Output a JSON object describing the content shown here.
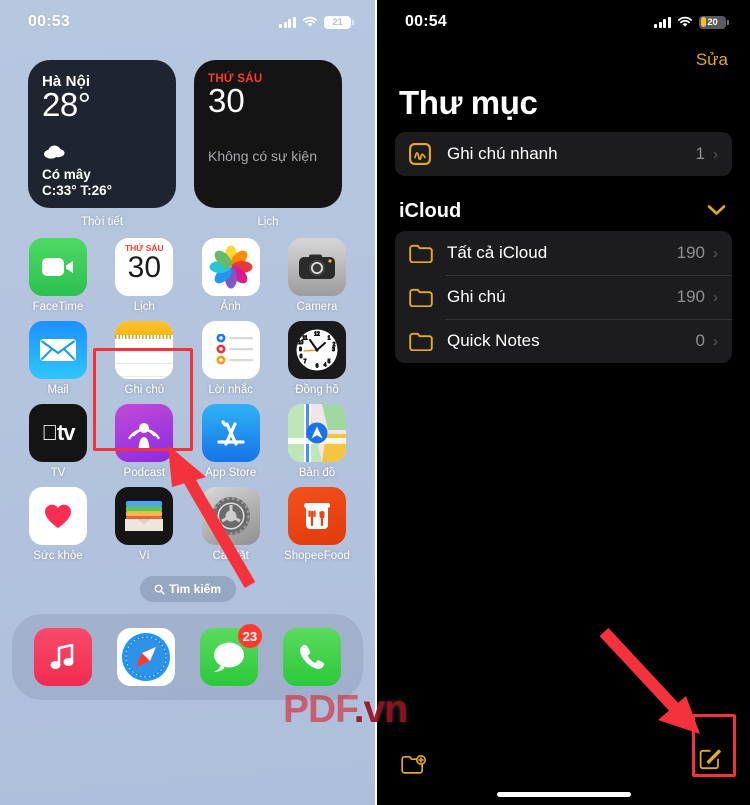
{
  "left_phone": {
    "status_bar": {
      "time": "00:53",
      "battery_level": "21",
      "wifi_icon": "wifi-icon",
      "signal_icon": "cellular-bars-icon"
    },
    "widgets": [
      {
        "name": "weather",
        "label": "Thời tiết",
        "city": "Hà Nội",
        "temperature": "28°",
        "condition": "Có mây",
        "high_low": "C:33° T:26°",
        "condition_icon": "cloud-icon"
      },
      {
        "name": "calendar",
        "label": "Lịch",
        "day_of_week": "THỨ SÁU",
        "day_number": "30",
        "empty_text": "Không có sự kiện"
      }
    ],
    "apps": [
      [
        {
          "label": "FaceTime",
          "icon": "facetime-icon"
        },
        {
          "label": "Lịch",
          "icon": "calendar-icon",
          "badge_dow": "THỨ SÁU",
          "badge_day": "30"
        },
        {
          "label": "Ảnh",
          "icon": "photos-icon"
        },
        {
          "label": "Camera",
          "icon": "camera-icon"
        }
      ],
      [
        {
          "label": "Mail",
          "icon": "mail-icon"
        },
        {
          "label": "Ghi chú",
          "icon": "notes-icon",
          "highlighted": true
        },
        {
          "label": "Lời nhắc",
          "icon": "reminders-icon"
        },
        {
          "label": "Đồng hồ",
          "icon": "clock-icon"
        }
      ],
      [
        {
          "label": "TV",
          "icon": "apple-tv-icon"
        },
        {
          "label": "Podcast",
          "icon": "podcasts-icon"
        },
        {
          "label": "App Store",
          "icon": "app-store-icon"
        },
        {
          "label": "Bản đồ",
          "icon": "maps-icon"
        }
      ],
      [
        {
          "label": "Sức khỏe",
          "icon": "health-icon"
        },
        {
          "label": "Ví",
          "icon": "wallet-icon"
        },
        {
          "label": "Cài đặt",
          "icon": "settings-gear-icon"
        },
        {
          "label": "ShopeeFood",
          "icon": "shopeefood-icon"
        }
      ]
    ],
    "search": {
      "label": "Tìm kiếm",
      "icon": "search-icon"
    },
    "dock": [
      {
        "label": "Music",
        "icon": "music-icon"
      },
      {
        "label": "Safari",
        "icon": "safari-compass-icon"
      },
      {
        "label": "Messages",
        "icon": "messages-icon",
        "badge": "23"
      },
      {
        "label": "Phone",
        "icon": "phone-icon"
      }
    ]
  },
  "right_phone": {
    "status_bar": {
      "time": "00:54",
      "battery_level": "20",
      "wifi_icon": "wifi-icon",
      "signal_icon": "cellular-bars-icon"
    },
    "nav": {
      "edit_label": "Sửa"
    },
    "title": "Thư mục",
    "quick_group": [
      {
        "title": "Ghi chú nhanh",
        "count": "1",
        "icon": "quick-note-icon",
        "chevron": "›"
      }
    ],
    "section": {
      "title": "iCloud",
      "collapse_icon": "chevron-down-icon"
    },
    "folders": [
      {
        "title": "Tất cả iCloud",
        "count": "190",
        "icon": "folder-icon",
        "chevron": "›"
      },
      {
        "title": "Ghi chú",
        "count": "190",
        "icon": "folder-icon",
        "chevron": "›"
      },
      {
        "title": "Quick Notes",
        "count": "0",
        "icon": "folder-icon",
        "chevron": "›"
      }
    ],
    "bottom_bar": {
      "new_folder_icon": "new-folder-icon",
      "compose_icon": "compose-note-icon",
      "compose_highlighted": true
    }
  },
  "annotations": {
    "watermark_part1": "PDF",
    "watermark_part2": ".vn",
    "highlight_color": "#f4323c",
    "arrow_left": "arrow-pointing-to-notes-app",
    "arrow_right": "arrow-pointing-to-compose-button"
  }
}
